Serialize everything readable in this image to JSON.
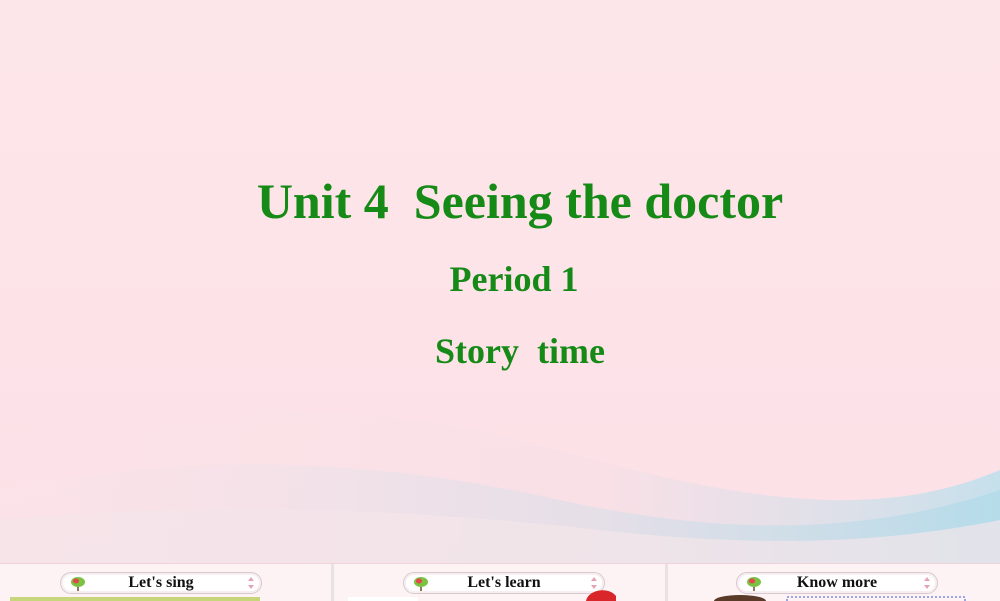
{
  "slide": {
    "title": "Unit 4  Seeing the doctor",
    "period": "Period 1",
    "section": "Story  time"
  },
  "colors": {
    "title_green": "#168a16",
    "background_pink": "#fde6ea",
    "wave_blue": "#bfe3ee"
  },
  "bottom_nav": {
    "items": [
      {
        "label": "Let's sing",
        "icon": "leaf-icon"
      },
      {
        "label": "Let's learn",
        "icon": "leaf-icon"
      },
      {
        "label": "Know more",
        "icon": "leaf-icon"
      }
    ]
  }
}
